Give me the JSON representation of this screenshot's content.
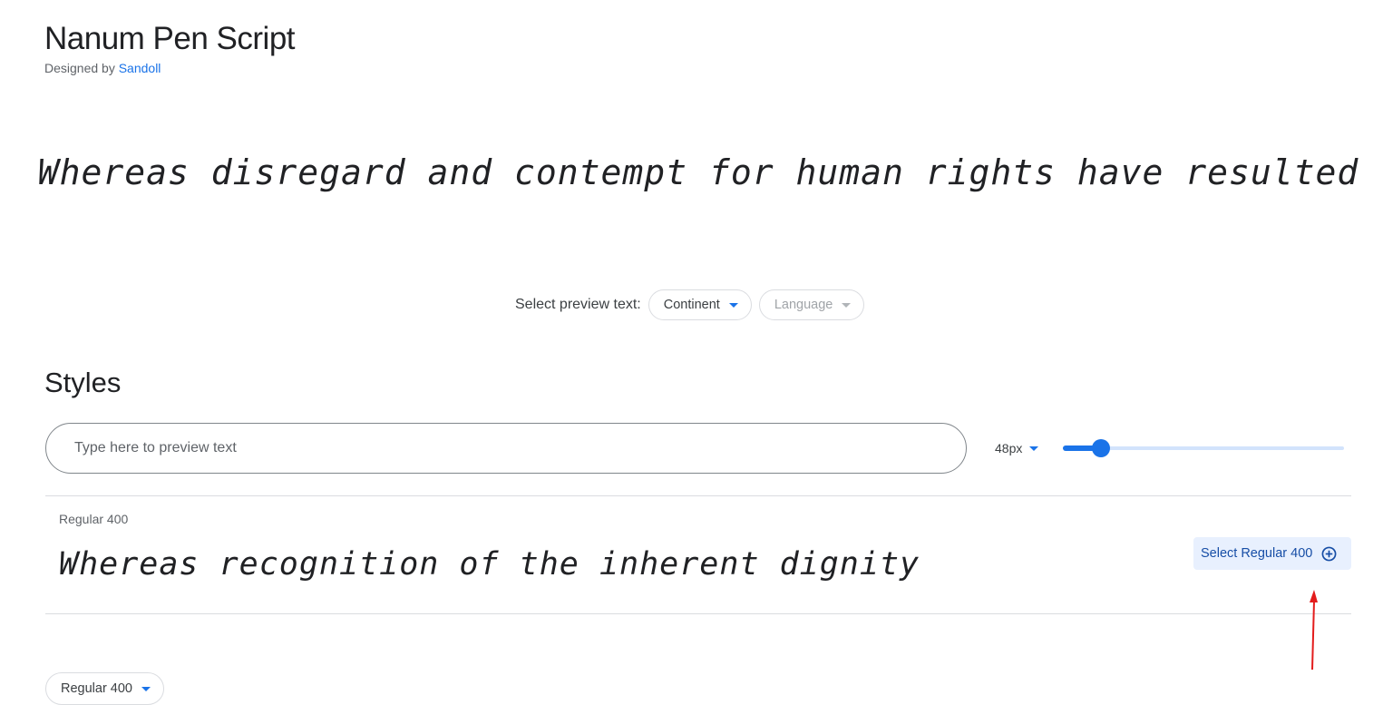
{
  "font": {
    "name": "Nanum Pen Script",
    "designed_by_label": "Designed by",
    "designer": "Sandoll"
  },
  "hero": {
    "preview_text": "Whereas disregard and contempt for human rights have resulted"
  },
  "preview_text_selector": {
    "label": "Select preview text:",
    "continent": "Continent",
    "language": "Language"
  },
  "styles": {
    "title": "Styles",
    "preview_input_placeholder": "Type here to preview text",
    "size_label": "48px",
    "slider_fraction": 0.135,
    "rows": [
      {
        "label": "Regular 400",
        "preview": "Whereas recognition of the inherent dignity",
        "select_button": "Select Regular 400"
      }
    ]
  },
  "bottom_selector": {
    "label": "Regular 400"
  },
  "colors": {
    "accent": "#1a73e8",
    "annotation": "#e31c1c",
    "button_bg": "#e8f0fe"
  }
}
